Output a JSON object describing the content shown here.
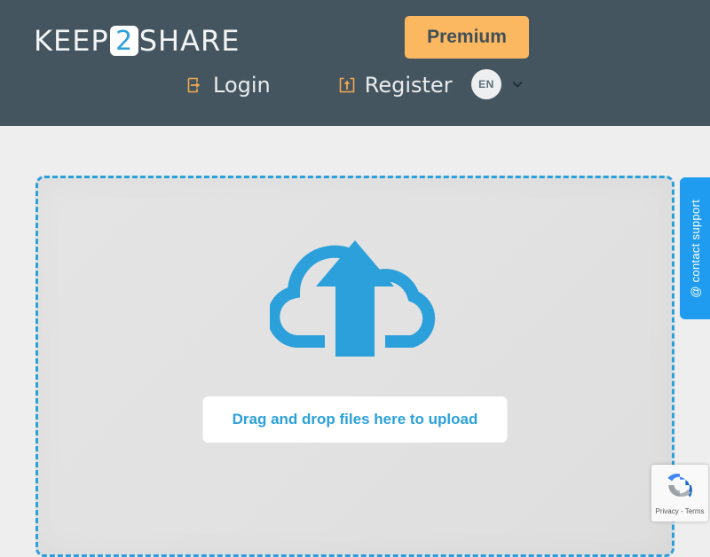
{
  "header": {
    "logo": {
      "part1": "KEEP",
      "badge": "2",
      "part2": "SHARE",
      "aria": "keep2share-logo"
    },
    "premium_label": "Premium",
    "nav": [
      {
        "label": "Login",
        "icon": "sign-in-icon"
      },
      {
        "label": "Register",
        "icon": "sign-up-icon"
      }
    ],
    "language": {
      "code": "EN",
      "chevron": "chevron-down-icon"
    }
  },
  "main": {
    "dropzone": {
      "icon": "cloud-upload-icon",
      "button_label": "Drag and drop files here to upload"
    }
  },
  "support": {
    "label": "@ contact support"
  },
  "recaptcha": {
    "links": "Privacy - Terms",
    "logo": "recaptcha-logo"
  },
  "colors": {
    "header_bg": "#45555f",
    "page_bg": "#eeeeee",
    "accent_blue": "#2ba0da",
    "premium_orange": "#fbb860",
    "support_blue": "#1f9cf0",
    "nav_icon_orange": "#f2a council"
  }
}
